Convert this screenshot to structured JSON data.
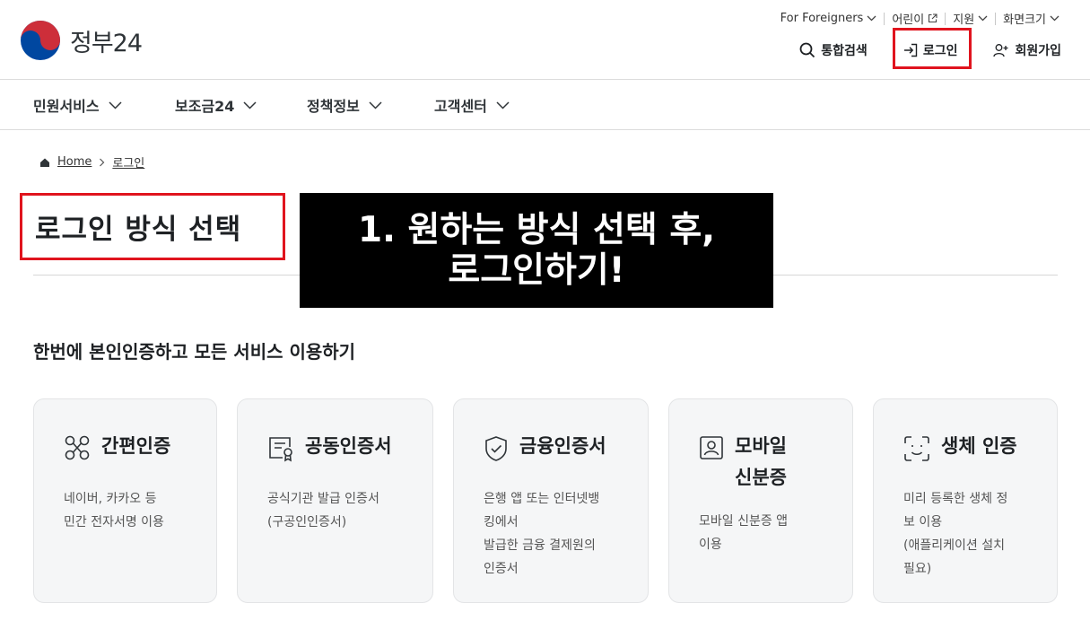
{
  "header": {
    "logo_text": "정부24",
    "util": [
      {
        "label": "For Foreigners",
        "icon": "chevron-down-icon"
      },
      {
        "label": "어린이",
        "icon": "external-link-icon"
      },
      {
        "label": "지원",
        "icon": "chevron-down-icon"
      },
      {
        "label": "화면크기",
        "icon": "chevron-down-icon"
      }
    ],
    "search_label": "통합검색",
    "login_label": "로그인",
    "signup_label": "회원가입"
  },
  "nav": [
    "민원서비스",
    "보조금24",
    "정책정보",
    "고객센터"
  ],
  "breadcrumb": {
    "home": "Home",
    "current": "로그인"
  },
  "page_title": "로그인 방식 선택",
  "overlay": {
    "line1": "1. 원하는 방식 선택 후,",
    "line2": "로그인하기!"
  },
  "subhead": "한번에 본인인증하고 모든 서비스 이용하기",
  "cards": [
    {
      "icon": "nodes-icon",
      "title": "간편인증",
      "desc": "네이버, 카카오 등\n민간 전자서명 이용"
    },
    {
      "icon": "certificate-icon",
      "title": "공동인증서",
      "desc": "공식기관 발급 인증서\n(구공인인증서)"
    },
    {
      "icon": "shield-check-icon",
      "title": "금융인증서",
      "desc": "은행 앱 또는 인터넷뱅\n킹에서\n발급한 금융 결제원의\n인증서"
    },
    {
      "icon": "id-card-icon",
      "title": "모바일\n신분증",
      "desc": "모바일 신분증 앱\n이용"
    },
    {
      "icon": "face-scan-icon",
      "title": "생체 인증",
      "desc": "미리 등록한 생체 정\n보 이용\n(애플리케이션 설치\n필요)"
    }
  ],
  "colors": {
    "highlight_red": "#e0141e",
    "logo_red": "#cd2e3a",
    "logo_blue": "#0047a0",
    "card_bg": "#f5f6f7"
  }
}
